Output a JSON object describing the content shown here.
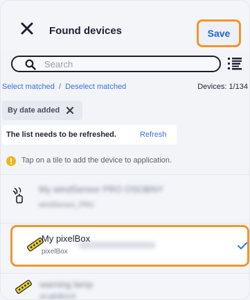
{
  "header": {
    "title": "Found devices",
    "save_label": "Save"
  },
  "search": {
    "placeholder": "Search"
  },
  "selection": {
    "select_matched": "Select matched",
    "separator": "/",
    "deselect_matched": "Deselect matched",
    "devices_count": "Devices: 1/134"
  },
  "filter_chip": {
    "label": "By date added"
  },
  "refresh_notice": {
    "text": "The list needs to be refreshed.",
    "link": "Refresh"
  },
  "hint": {
    "text": "Tap on a tile to add the device to application."
  },
  "devices": [
    {
      "name": "My windSensor PRO OSOBNY",
      "type": "windSensor_PRO",
      "icon": "wind-sensor-icon",
      "selected": false,
      "blurred": true
    },
    {
      "name": "My pixelBox",
      "type": "pixelBox",
      "icon": "led-strip-icon",
      "selected": true,
      "blurred": false
    },
    {
      "name": "warning lamp",
      "type": "wLightBoxS",
      "icon": "led-strip-icon",
      "selected": false,
      "blurred": true
    }
  ],
  "colors": {
    "accent_blue": "#1f64d6",
    "link_blue": "#3a73d8",
    "highlight_orange": "#f0962e",
    "hint_yellow": "#f3b320",
    "strip_yellow": "#e9cf28"
  }
}
